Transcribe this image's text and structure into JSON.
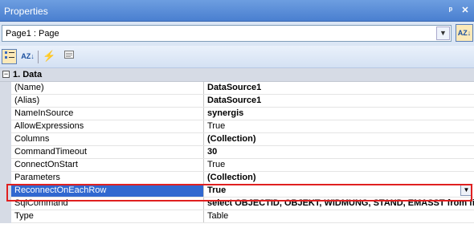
{
  "window": {
    "title": "Properties",
    "pin_glyph": "ᵖ",
    "close_glyph": "✕"
  },
  "object_selector": {
    "value": "Page1 : Page"
  },
  "category": {
    "label": "1. Data",
    "toggle": "−"
  },
  "properties": [
    {
      "name": "(Name)",
      "value": "DataSource1",
      "bold": true
    },
    {
      "name": "(Alias)",
      "value": "DataSource1",
      "bold": true
    },
    {
      "name": "NameInSource",
      "value": "synergis",
      "bold": true
    },
    {
      "name": "AllowExpressions",
      "value": "True",
      "bold": false
    },
    {
      "name": "Columns",
      "value": "(Collection)",
      "bold": true
    },
    {
      "name": "CommandTimeout",
      "value": "30",
      "bold": true
    },
    {
      "name": "ConnectOnStart",
      "value": "True",
      "bold": false
    },
    {
      "name": "Parameters",
      "value": "(Collection)",
      "bold": true
    },
    {
      "name": "ReconnectOnEachRow",
      "value": "True",
      "bold": true,
      "selected": true
    },
    {
      "name": "SqlCommand",
      "value": "select OBJECTID, OBJEKT, WIDMUNG, STAND, EMASST from fiw",
      "bold": true
    },
    {
      "name": "Type",
      "value": "Table",
      "bold": false
    }
  ],
  "colors": {
    "selection": "#3168d0",
    "highlight_box": "#e02020",
    "titlebar": "#5a8ad8"
  }
}
